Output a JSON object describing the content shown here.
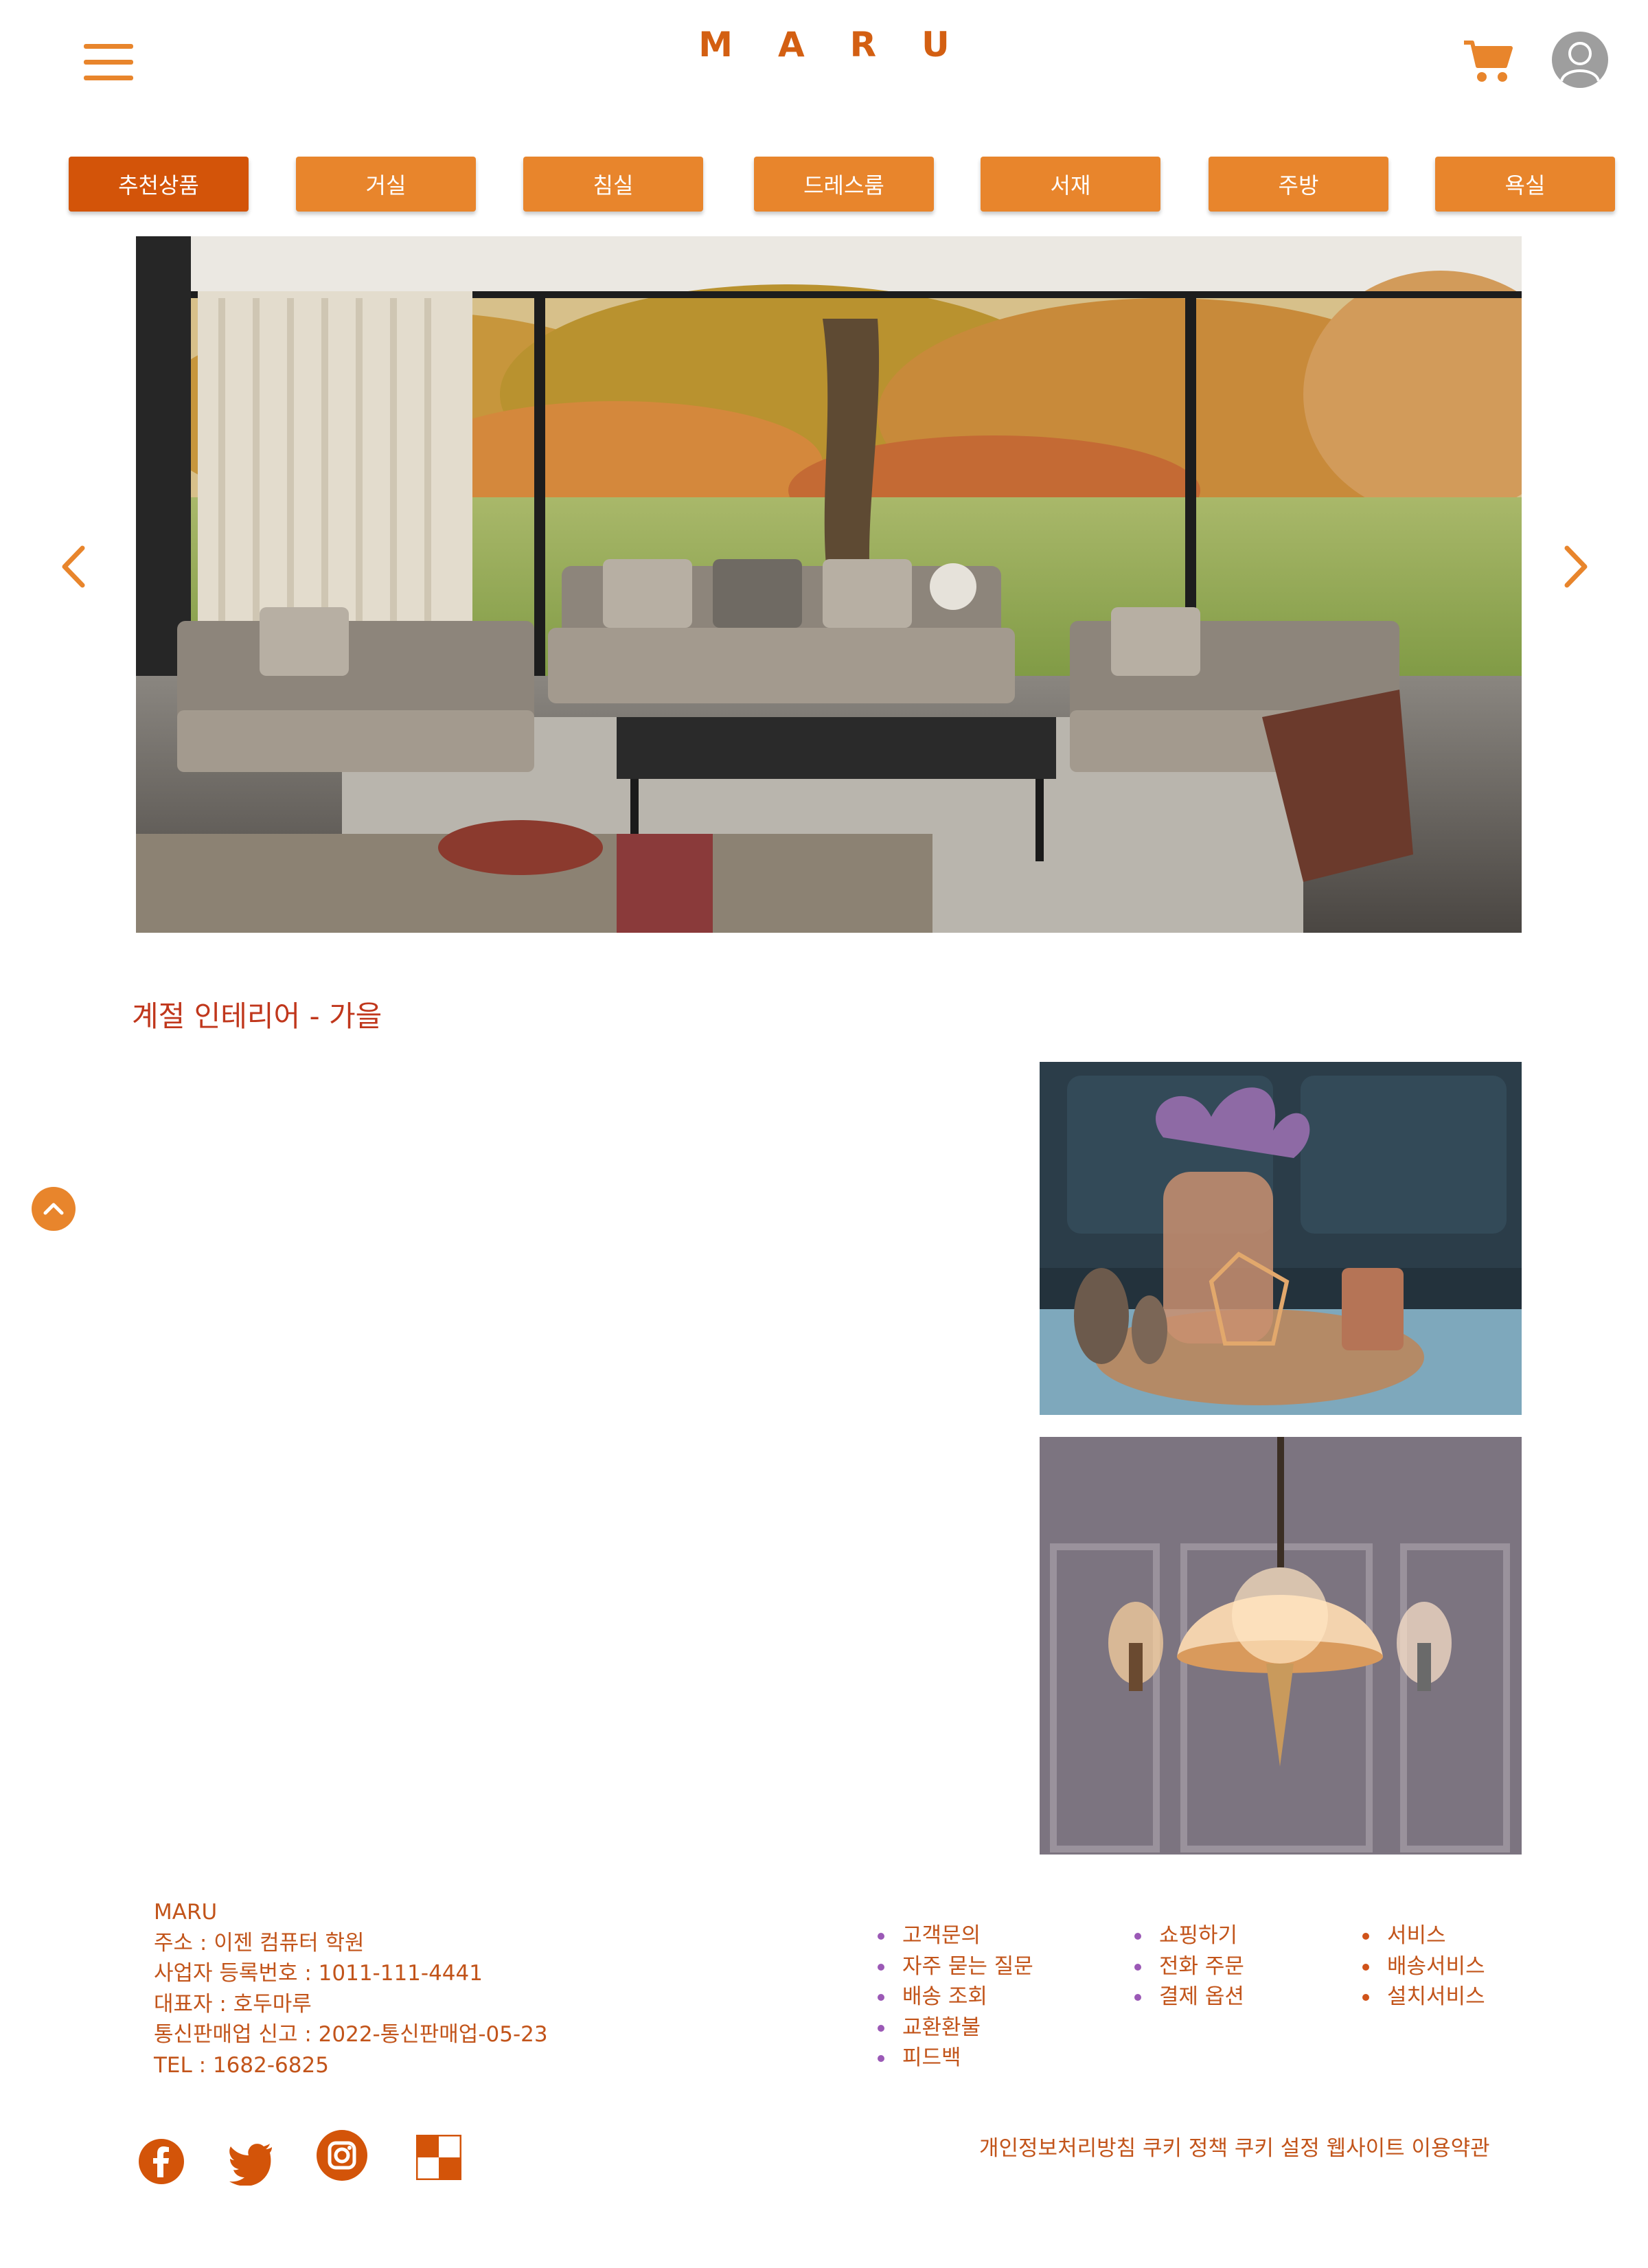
{
  "header": {
    "logo": "MARU",
    "menu_icon": "hamburger-icon",
    "cart_icon": "cart-icon",
    "user_icon": "user-icon"
  },
  "tabs": [
    {
      "label": "추천상품",
      "active": true
    },
    {
      "label": "거실"
    },
    {
      "label": "침실"
    },
    {
      "label": "드레스룸"
    },
    {
      "label": "서재"
    },
    {
      "label": "주방"
    },
    {
      "label": "욕실"
    }
  ],
  "carousel": {
    "slide_count": 3,
    "active_index": 1,
    "prev_icon": "chevron-left-icon",
    "next_icon": "chevron-right-icon"
  },
  "section": {
    "title": "계절 인테리어 - 가을"
  },
  "scroll_top_icon": "chevron-up-icon",
  "footer": {
    "company": "MARU",
    "address": "주소 : 이젠 컴퓨터 학원",
    "business_no": "사업자 등록번호 : 1011-111-4441",
    "ceo": "대표자 : 호두마루",
    "mail_order": "통신판매업 신고 : 2022-통신판매업-05-23",
    "tel": "TEL : 1682-6825",
    "col_support": [
      "고객문의",
      "자주 묻는 질문",
      "배송 조회",
      "교환환불",
      "피드백"
    ],
    "col_shopping": [
      "쇼핑하기",
      "전화 주문",
      "결제 옵션"
    ],
    "col_service": [
      "서비스",
      "배송서비스",
      "설치서비스"
    ],
    "legal": [
      "개인정보처리방침",
      "쿠키 정책",
      "쿠키 설정",
      "웹사이트 이용약관"
    ],
    "social_icons": [
      "facebook-icon",
      "twitter-icon",
      "instagram-icon",
      "checker-icon"
    ]
  },
  "colors": {
    "accent": "#e8852c",
    "accent_dark": "#d35409",
    "title_red": "#c0371c",
    "text": "#c2541a"
  }
}
